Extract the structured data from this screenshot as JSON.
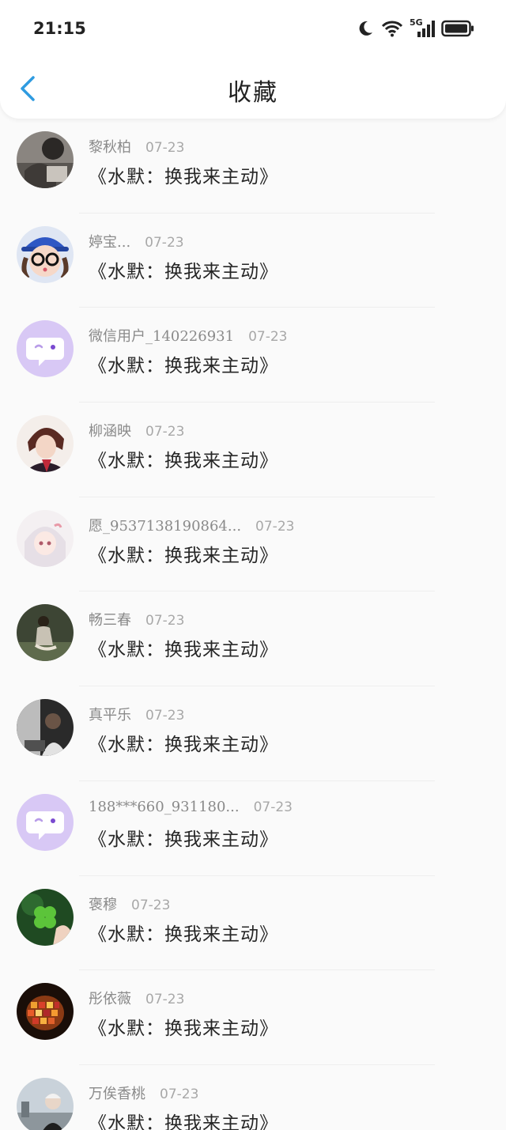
{
  "status_bar": {
    "time": "21:15",
    "network_label": "5G",
    "icons": [
      "moon-icon",
      "wifi-icon",
      "signal-icon",
      "battery-icon"
    ]
  },
  "header": {
    "title": "收藏",
    "back_icon": "chevron-left-icon",
    "accent_color": "#2f9be0"
  },
  "items": [
    {
      "name": "黎秋柏",
      "date": "07-23",
      "text": "《水默：换我来主动》",
      "avatar": "photo-dark"
    },
    {
      "name": "婷宝...",
      "date": "07-23",
      "text": "《水默：换我来主动》",
      "avatar": "cartoon-girl"
    },
    {
      "name": "微信用户_140226931",
      "date": "07-23",
      "text": "《水默：换我来主动》",
      "avatar": "chat-bubble"
    },
    {
      "name": "柳涵映",
      "date": "07-23",
      "text": "《水默：换我来主动》",
      "avatar": "anime-boy"
    },
    {
      "name": "愿_9537138190864...",
      "date": "07-23",
      "text": "《水默：换我来主动》",
      "avatar": "anime-girl"
    },
    {
      "name": "畅三春",
      "date": "07-23",
      "text": "《水默：换我来主动》",
      "avatar": "photo-nature"
    },
    {
      "name": "真平乐",
      "date": "07-23",
      "text": "《水默：换我来主动》",
      "avatar": "photo-car"
    },
    {
      "name": "188***660_931180...",
      "date": "07-23",
      "text": "《水默：换我来主动》",
      "avatar": "chat-bubble"
    },
    {
      "name": "褒穆",
      "date": "07-23",
      "text": "《水默：换我来主动》",
      "avatar": "clover"
    },
    {
      "name": "彤依薇",
      "date": "07-23",
      "text": "《水默：换我来主动》",
      "avatar": "mosaic-lamp"
    },
    {
      "name": "万俟香桃",
      "date": "07-23",
      "text": "《水默：换我来主动》",
      "avatar": "photo-street"
    }
  ]
}
